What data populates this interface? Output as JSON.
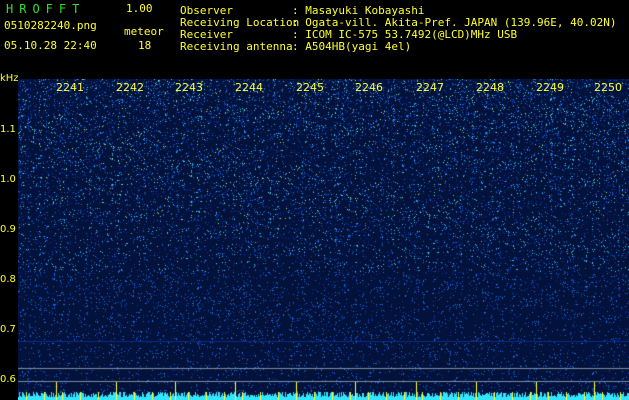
{
  "header": {
    "app_name": "HROFFT",
    "version": "1.00",
    "filename": "0510282240.png",
    "datetime": "05.10.28 22:40",
    "meteor_label": "meteor",
    "meteor_count": "18"
  },
  "info": [
    {
      "label": "Observer",
      "value": ": Masayuki Kobayashi"
    },
    {
      "label": "Receiving Location",
      "value": ": Ogata-vill. Akita-Pref. JAPAN (139.96E, 40.02N)"
    },
    {
      "label": "Receiver",
      "value": ": ICOM IC-575 53.7492(@LCD)MHz USB"
    },
    {
      "label": "Receiving antenna",
      "value": ": A504HB(yagi 4el)"
    }
  ],
  "freq_axis": {
    "unit": "kHz",
    "ticks": [
      "1.1",
      "1.0",
      "0.9",
      "0.8",
      "0.7",
      "0.6"
    ]
  },
  "time_axis": {
    "minutes": [
      "2241",
      "2242",
      "2243",
      "2244",
      "2245",
      "2246",
      "2247",
      "2248",
      "2249",
      "2250"
    ]
  },
  "colors": {
    "label_yellow": "#ffff33",
    "title_green": "#2ee02e",
    "background": "#000000",
    "spectrogram_base": "#03123a",
    "noise_cyan": "#33e6ff"
  }
}
